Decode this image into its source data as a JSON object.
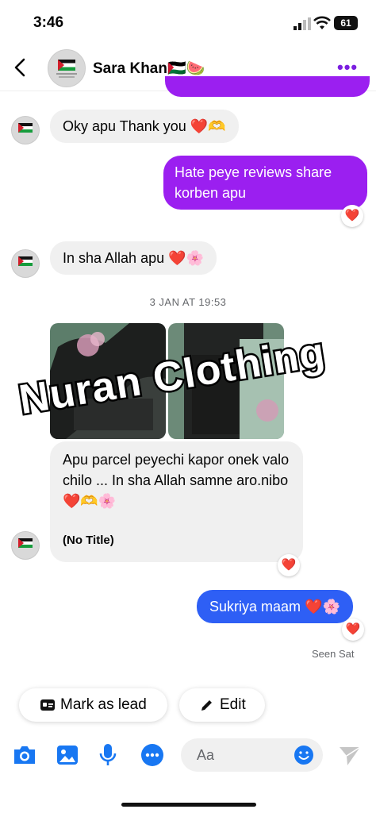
{
  "status_bar": {
    "time": "3:46",
    "battery": "61"
  },
  "header": {
    "contact_name": "Sara Khan🇵🇸🍉",
    "more_icon": "more-dots-icon",
    "back_icon": "chevron-left-icon"
  },
  "messages": [
    {
      "direction": "in",
      "text": "Oky apu Thank you ❤️🫶"
    },
    {
      "direction": "out",
      "text": "Hate peye reviews share korben apu",
      "reaction": "❤️"
    },
    {
      "direction": "in",
      "text": "In sha Allah apu ❤️🌸"
    },
    {
      "direction": "in",
      "text": "Apu parcel peyechi kapor  onek valo chilo ... In sha Allah samne aro.nibo ❤️🫶🌸",
      "attachment_title": "(No Title)",
      "reaction": "❤️"
    },
    {
      "direction": "out",
      "text": "Sukriya maam ❤️🌸",
      "reaction": "❤️"
    }
  ],
  "date_separator": "3 JAN AT 19:53",
  "watermark": "Nuran Clothing",
  "seen_status": "Seen Sat",
  "quick_actions": {
    "lead": "Mark as lead",
    "edit": "Edit"
  },
  "composer": {
    "placeholder": "Aa"
  },
  "colors": {
    "purple": "#9b1ff0",
    "blue": "#2e5ff5",
    "icon_blue": "#1877f2"
  }
}
